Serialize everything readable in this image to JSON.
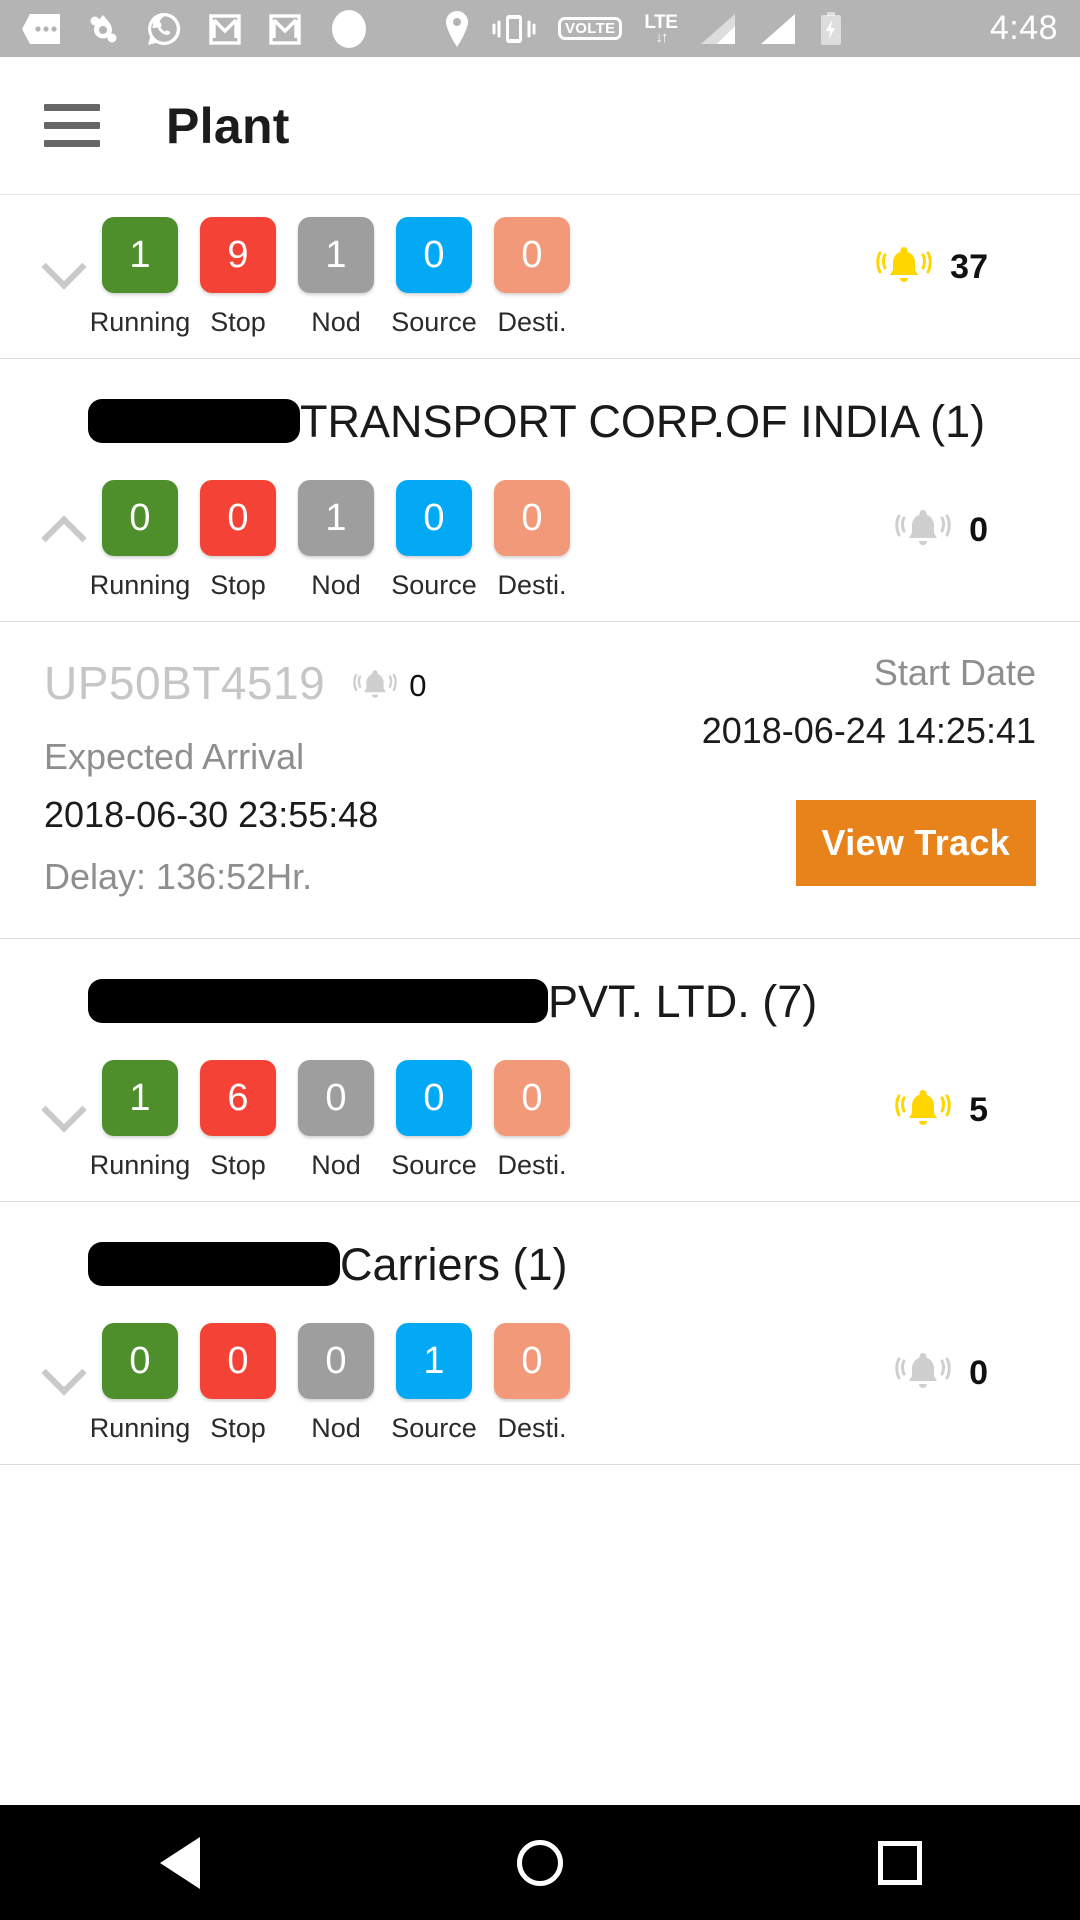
{
  "statusbar": {
    "icons": [
      "sim-dots-icon",
      "droplet-sync-icon",
      "whatsapp-icon",
      "gmail-icon",
      "gmail-icon",
      "circle-icon",
      "location-pin-icon",
      "vibrate-icon",
      "volte-icon",
      "lte-data-icon",
      "signal-bar-icon",
      "signal-bar-icon",
      "battery-charging-icon"
    ],
    "volte_label": "VOLTE",
    "lte_label": "LTE",
    "lte_arrows": "↓↑",
    "clock": "4:48"
  },
  "appbar": {
    "menu_icon": "hamburger-menu-icon",
    "title": "Plant"
  },
  "status_labels": [
    "Running",
    "Stop",
    "Nod",
    "Source",
    "Desti."
  ],
  "colors": {
    "running": "#4e8f2b",
    "stop": "#f44336",
    "nod": "#9e9e9e",
    "source": "#03a9f4",
    "desti": "#f2997a",
    "accent_button": "#e8821a",
    "alert_active": "#ffd600",
    "alert_inactive": "#cfcfcf"
  },
  "cards": [
    {
      "id": "summary-card",
      "title": null,
      "expanded": false,
      "chevron": "chevron-down-icon",
      "counts": [
        "1",
        "9",
        "1",
        "0",
        "0"
      ],
      "alert_icon": "bell-active-icon",
      "alert_count": "37"
    },
    {
      "id": "transport-corp-card",
      "title_redacted": true,
      "title": "TRANSPORT CORP.OF INDIA (1)",
      "expanded": true,
      "chevron": "chevron-up-icon",
      "counts": [
        "0",
        "0",
        "1",
        "0",
        "0"
      ],
      "alert_icon": "bell-inactive-icon",
      "alert_count": "0"
    },
    {
      "id": "pvt-ltd-card",
      "title_redacted": true,
      "title": "PVT. LTD. (7)",
      "expanded": false,
      "chevron": "chevron-down-icon",
      "counts": [
        "1",
        "6",
        "0",
        "0",
        "0"
      ],
      "alert_icon": "bell-active-icon",
      "alert_count": "5"
    },
    {
      "id": "carriers-card",
      "title_redacted": true,
      "title": "Carriers (1)",
      "expanded": false,
      "chevron": "chevron-down-icon",
      "counts": [
        "0",
        "0",
        "0",
        "1",
        "0"
      ],
      "alert_icon": "bell-inactive-icon",
      "alert_count": "0"
    }
  ],
  "vehicle_detail": {
    "vehicle_number": "UP50BT4519",
    "alert_icon": "bell-inactive-icon",
    "alert_count": "0",
    "start_date_label": "Start Date",
    "start_date_value": "2018-06-24 14:25:41",
    "expected_arrival_label": "Expected Arrival",
    "expected_arrival_value": "2018-06-30 23:55:48",
    "delay_text": "Delay: 136:52Hr.",
    "view_track_label": "View Track"
  },
  "navbar": {
    "back": "back-triangle-icon",
    "home": "home-circle-icon",
    "recents": "recents-square-icon"
  }
}
